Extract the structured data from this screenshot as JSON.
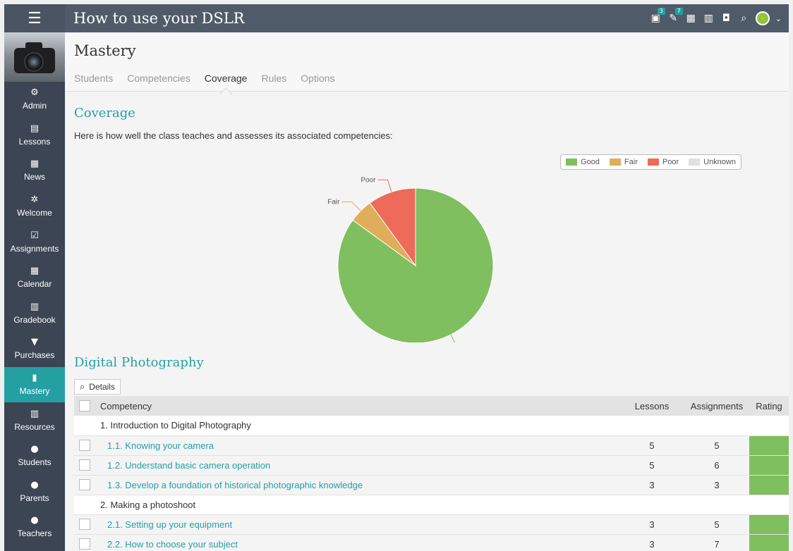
{
  "app": {
    "course_title": "How to use your DSLR",
    "menu_icon": "hamburger-icon"
  },
  "topbar": {
    "icons": [
      {
        "name": "classes-icon",
        "badge": "3"
      },
      {
        "name": "notifications-icon",
        "badge": "7"
      },
      {
        "name": "calendar-icon",
        "badge": ""
      },
      {
        "name": "trash-icon",
        "badge": ""
      },
      {
        "name": "help-icon",
        "badge": ""
      },
      {
        "name": "search-icon",
        "badge": ""
      }
    ]
  },
  "sidebar": {
    "items": [
      {
        "label": "Admin",
        "icon": "gear-icon",
        "glyph": "⚙"
      },
      {
        "label": "Lessons",
        "icon": "lessons-icon",
        "glyph": "▤"
      },
      {
        "label": "News",
        "icon": "news-icon",
        "glyph": "▦"
      },
      {
        "label": "Welcome",
        "icon": "welcome-icon",
        "glyph": "✲"
      },
      {
        "label": "Assignments",
        "icon": "assignments-icon",
        "glyph": "☑"
      },
      {
        "label": "Calendar",
        "icon": "calendar-icon",
        "glyph": "▦"
      },
      {
        "label": "Gradebook",
        "icon": "gradebook-icon",
        "glyph": "▥"
      },
      {
        "label": "Purchases",
        "icon": "cart-icon",
        "glyph": "▼"
      },
      {
        "label": "Mastery",
        "icon": "mastery-chart-icon",
        "glyph": "▮",
        "active": true
      },
      {
        "label": "Resources",
        "icon": "resources-icon",
        "glyph": "▥"
      },
      {
        "label": "Students",
        "icon": "student-icon",
        "glyph": "●"
      },
      {
        "label": "Parents",
        "icon": "parent-icon",
        "glyph": "●"
      },
      {
        "label": "Teachers",
        "icon": "teacher-icon",
        "glyph": "●"
      }
    ]
  },
  "page": {
    "title": "Mastery",
    "tabs": [
      "Students",
      "Competencies",
      "Coverage",
      "Rules",
      "Options"
    ],
    "active_tab": "Coverage"
  },
  "coverage": {
    "title": "Coverage",
    "description": "Here is how well the class teaches and assesses its associated competencies:"
  },
  "chart_data": {
    "type": "pie",
    "slices": [
      {
        "label": "Good",
        "value": 85,
        "color": "#7fbf5f"
      },
      {
        "label": "Fair",
        "value": 5,
        "color": "#e0ad5a"
      },
      {
        "label": "Poor",
        "value": 10,
        "color": "#ee6a5a"
      },
      {
        "label": "Unknown",
        "value": 0,
        "color": "#e0e0e0"
      }
    ],
    "legend": [
      "Good",
      "Fair",
      "Poor",
      "Unknown"
    ],
    "legend_position": "top-right"
  },
  "competencies": {
    "title": "Digital Photography",
    "details_label": "Details",
    "columns": {
      "name": "Competency",
      "lessons": "Lessons",
      "assignments": "Assignments",
      "rating": "Rating"
    },
    "rows": [
      {
        "type": "group",
        "name": "1. Introduction to Digital Photography"
      },
      {
        "type": "item",
        "name": "1.1. Knowing your camera",
        "lessons": "5",
        "assignments": "5",
        "rating": "good"
      },
      {
        "type": "item",
        "name": "1.2. Understand basic camera operation",
        "lessons": "5",
        "assignments": "6",
        "rating": "good"
      },
      {
        "type": "item",
        "name": "1.3. Develop a foundation of historical photographic knowledge",
        "lessons": "3",
        "assignments": "3",
        "rating": "good"
      },
      {
        "type": "group",
        "name": "2. Making a photoshoot"
      },
      {
        "type": "item",
        "name": "2.1. Setting up your equipment",
        "lessons": "3",
        "assignments": "5",
        "rating": "good"
      },
      {
        "type": "item",
        "name": "2.2. How to choose your subject",
        "lessons": "3",
        "assignments": "7",
        "rating": "good"
      }
    ]
  }
}
